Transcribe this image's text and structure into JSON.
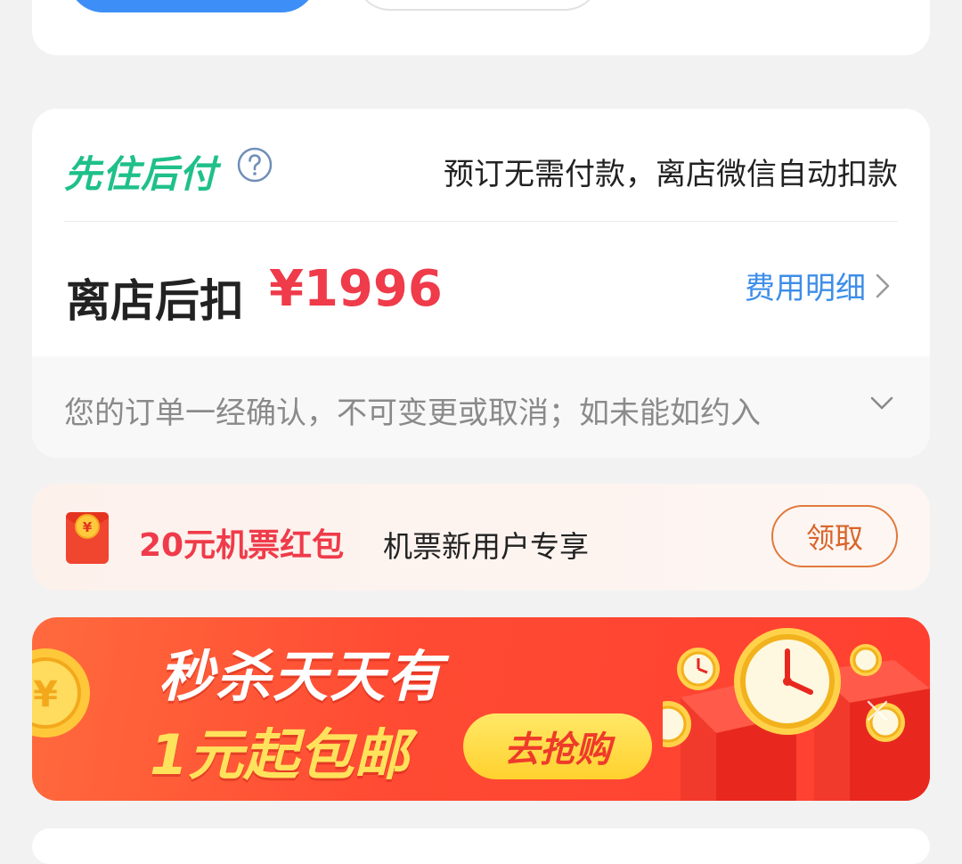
{
  "pay_later": {
    "brand": "先住后付",
    "description": "预订无需付款，离店微信自动扣款",
    "deduct_label": "离店后扣",
    "deduct_price": "¥1996",
    "fee_link": "费用明细",
    "notice": "您的订单一经确认，不可变更或取消；如未能如约入"
  },
  "red_packet": {
    "title": "20元机票红包",
    "subtitle": "机票新用户专享",
    "claim_button": "领取"
  },
  "banner": {
    "title": "秒杀天天有",
    "subtitle": "1元起包邮",
    "cta": "去抢购"
  },
  "colors": {
    "brand_green": "#1fc08a",
    "price_red": "#ef3b4a",
    "link_blue": "#3d8ee8",
    "claim_orange": "#e07a3c",
    "primary_blue": "#3e8ef7"
  },
  "icons": {
    "help": "help-circle-icon",
    "fee_chevron": "chevron-right-icon",
    "notice_expand": "chevron-down-icon",
    "packet": "red-envelope-icon",
    "banner_close": "close-icon"
  }
}
